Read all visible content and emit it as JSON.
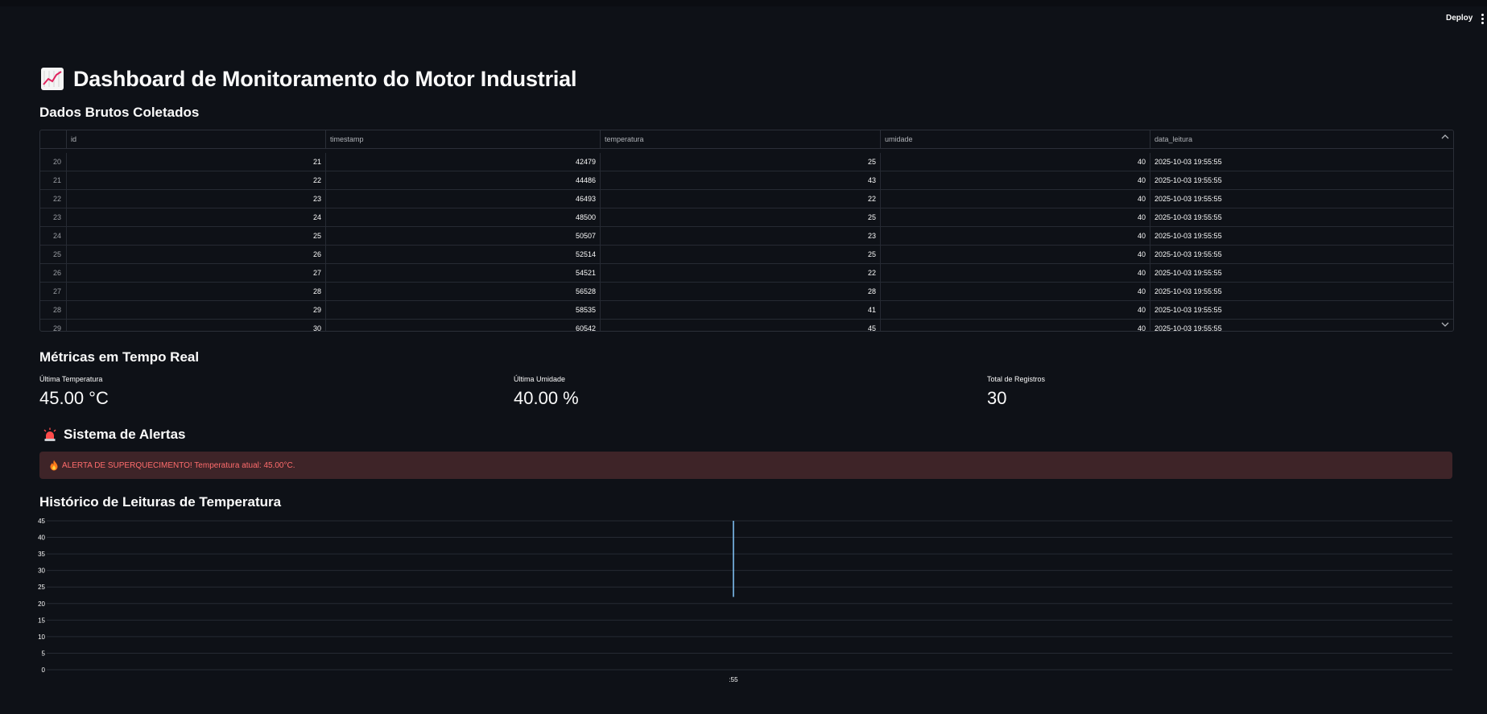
{
  "header": {
    "deploy_label": "Deploy",
    "menu_icon": "more-vert-icon"
  },
  "page": {
    "title": "Dashboard de Monitoramento do Motor Industrial",
    "title_icon": "chart-increasing-icon"
  },
  "raw_data": {
    "heading": "Dados Brutos Coletados",
    "columns": [
      "id",
      "timestamp",
      "temperatura",
      "umidade",
      "data_leitura"
    ],
    "rows": [
      {
        "index": "20",
        "id": "21",
        "timestamp": "42479",
        "temperatura": "25",
        "umidade": "40",
        "data_leitura": "2025-10-03 19:55:55"
      },
      {
        "index": "21",
        "id": "22",
        "timestamp": "44486",
        "temperatura": "43",
        "umidade": "40",
        "data_leitura": "2025-10-03 19:55:55"
      },
      {
        "index": "22",
        "id": "23",
        "timestamp": "46493",
        "temperatura": "22",
        "umidade": "40",
        "data_leitura": "2025-10-03 19:55:55"
      },
      {
        "index": "23",
        "id": "24",
        "timestamp": "48500",
        "temperatura": "25",
        "umidade": "40",
        "data_leitura": "2025-10-03 19:55:55"
      },
      {
        "index": "24",
        "id": "25",
        "timestamp": "50507",
        "temperatura": "23",
        "umidade": "40",
        "data_leitura": "2025-10-03 19:55:55"
      },
      {
        "index": "25",
        "id": "26",
        "timestamp": "52514",
        "temperatura": "25",
        "umidade": "40",
        "data_leitura": "2025-10-03 19:55:55"
      },
      {
        "index": "26",
        "id": "27",
        "timestamp": "54521",
        "temperatura": "22",
        "umidade": "40",
        "data_leitura": "2025-10-03 19:55:55"
      },
      {
        "index": "27",
        "id": "28",
        "timestamp": "56528",
        "temperatura": "28",
        "umidade": "40",
        "data_leitura": "2025-10-03 19:55:55"
      },
      {
        "index": "28",
        "id": "29",
        "timestamp": "58535",
        "temperatura": "41",
        "umidade": "40",
        "data_leitura": "2025-10-03 19:55:55"
      },
      {
        "index": "29",
        "id": "30",
        "timestamp": "60542",
        "temperatura": "45",
        "umidade": "40",
        "data_leitura": "2025-10-03 19:55:55"
      }
    ]
  },
  "metrics": {
    "heading": "Métricas em Tempo Real",
    "items": [
      {
        "label": "Última Temperatura",
        "value": "45.00 °C"
      },
      {
        "label": "Última Umidade",
        "value": "40.00 %"
      },
      {
        "label": "Total de Registros",
        "value": "30"
      }
    ]
  },
  "alerts": {
    "heading": "Sistema de Alertas",
    "heading_icon": "siren-icon",
    "message": "ALERTA DE SUPERQUECIMENTO! Temperatura atual: 45.00°C.",
    "message_icon": "fire-icon",
    "colors": {
      "background": "#3e2428",
      "text": "#ff6c6c"
    }
  },
  "history": {
    "heading": "Histórico de Leituras de Temperatura"
  },
  "chart_data": {
    "type": "line",
    "title": "",
    "xlabel": "",
    "ylabel": "",
    "ylim": [
      0,
      45
    ],
    "y_ticks": [
      "0",
      "5",
      "10",
      "15",
      "20",
      "25",
      "30",
      "35",
      "40",
      "45"
    ],
    "x_ticks": [
      ":55"
    ],
    "grid": true,
    "x": [
      ":55"
    ],
    "series": [
      {
        "values_min": 22,
        "values_max": 45
      }
    ],
    "colors": {
      "line": "#83c9ff",
      "grid": "#262a33"
    }
  }
}
